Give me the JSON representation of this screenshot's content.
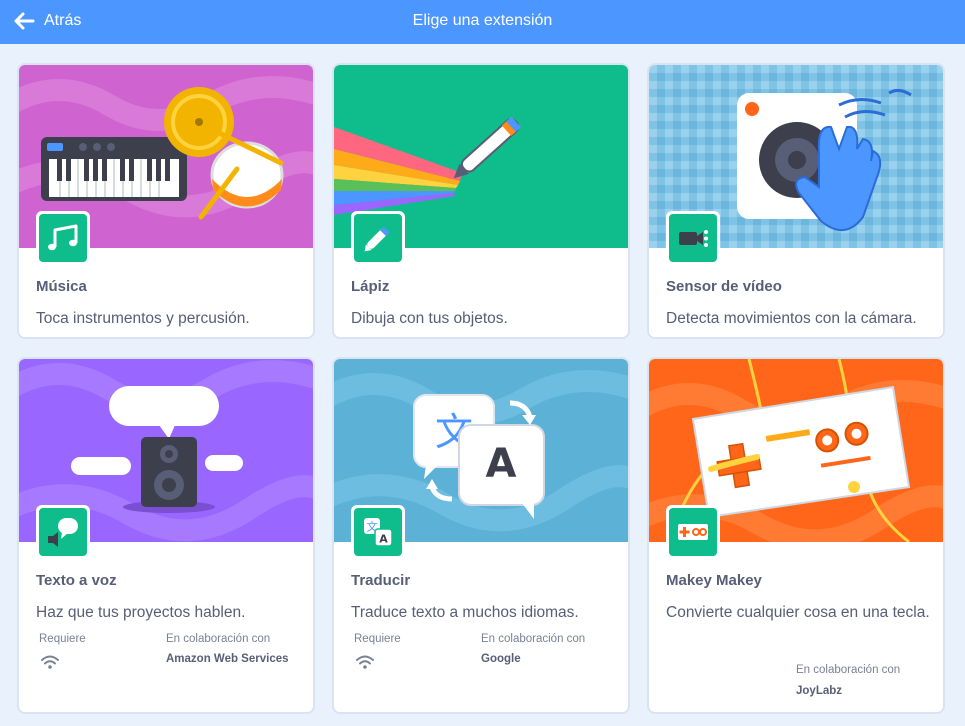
{
  "header": {
    "back_label": "Atrás",
    "title": "Elige una extensión"
  },
  "colors": {
    "header_bg": "#4c97ff",
    "accent_green": "#0fbd8c",
    "page_bg": "#e9f1fc",
    "text": "#575e75"
  },
  "extensions": [
    {
      "name": "Música",
      "description": "Toca instrumentos y percusión.",
      "icon": "music-notes-icon"
    },
    {
      "name": "Lápiz",
      "description": "Dibuja con tus objetos.",
      "icon": "pen-icon"
    },
    {
      "name": "Sensor de vídeo",
      "description": "Detecta movimientos con la cámara.",
      "icon": "video-camera-icon"
    },
    {
      "name": "Texto a voz",
      "description": "Haz que tus proyectos hablen.",
      "icon": "speech-bubble-icon",
      "requires_label": "Requiere",
      "requires_icon": "wifi-icon",
      "collab_label": "En colaboración con",
      "collab_name": "Amazon Web Services"
    },
    {
      "name": "Traducir",
      "description": "Traduce texto a muchos idiomas.",
      "icon": "translate-icon",
      "requires_label": "Requiere",
      "requires_icon": "wifi-icon",
      "collab_label": "En colaboración con",
      "collab_name": "Google"
    },
    {
      "name": "Makey Makey",
      "description": "Convierte cualquier cosa en una tecla.",
      "icon": "makey-makey-icon",
      "collab_label": "En colaboración con",
      "collab_name": "JoyLabz"
    }
  ]
}
